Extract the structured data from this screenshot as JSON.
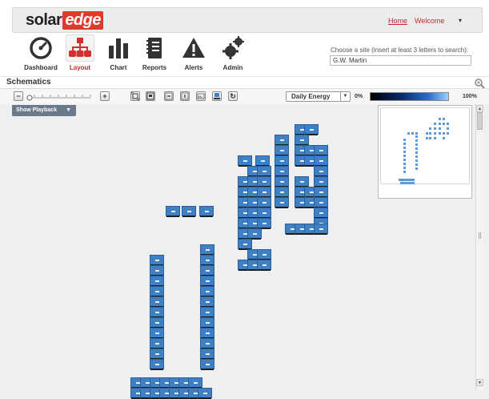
{
  "header": {
    "logo_text": "solar",
    "logo_highlight": "edge",
    "home_link": "Home",
    "welcome_label": "Welcome",
    "menu_caret": "▾"
  },
  "nav": {
    "items": [
      {
        "label": "Dashboard",
        "icon": "gauge-icon",
        "active": false
      },
      {
        "label": "Layout",
        "icon": "layout-tree-icon",
        "active": true
      },
      {
        "label": "Chart",
        "icon": "bar-chart-icon",
        "active": false
      },
      {
        "label": "Reports",
        "icon": "notebook-icon",
        "active": false
      },
      {
        "label": "Alerts",
        "icon": "warning-icon",
        "active": false
      },
      {
        "label": "Admin",
        "icon": "gears-icon",
        "active": false
      }
    ]
  },
  "site_search": {
    "prompt": "Choose a site (insert at least 3 letters to search):",
    "value": "G.W. Martin"
  },
  "schematics": {
    "title": "Schematics"
  },
  "toolbar": {
    "zoom_out_label": "−",
    "zoom_in_label": "+",
    "refresh_label": "↻",
    "metric_select": "Daily Energy",
    "scale_min": "0%",
    "scale_max": "100%",
    "gradient_colors": [
      "#000000",
      "#0a2a6a",
      "#2f6fc9",
      "#9ed0ff"
    ]
  },
  "canvas": {
    "playback_label": "Show Playback",
    "panel_color": "#3f7fc4"
  }
}
